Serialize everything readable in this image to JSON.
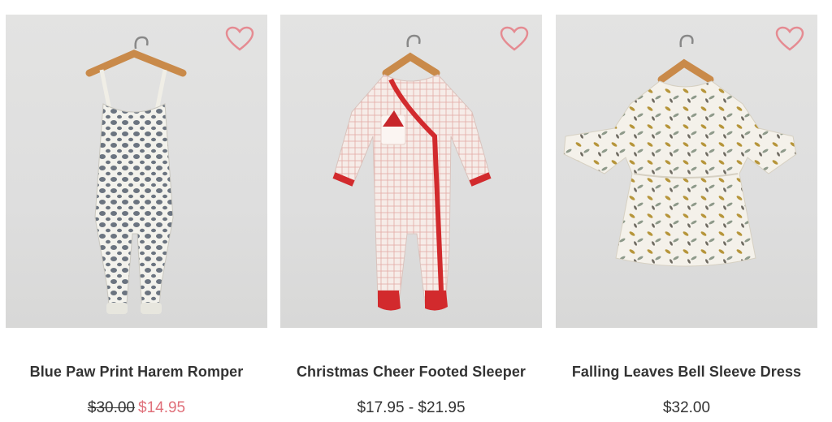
{
  "products": [
    {
      "title": "Blue Paw Print Harem Romper",
      "old_price": "$30.00",
      "price": "$14.95",
      "image_icon": "romper-image",
      "wishlist_icon": "heart-outline-icon"
    },
    {
      "title": "Christmas Cheer Footed Sleeper",
      "price": "$17.95 - $21.95",
      "image_icon": "sleeper-image",
      "wishlist_icon": "heart-outline-icon"
    },
    {
      "title": "Falling Leaves Bell Sleeve Dress",
      "price": "$32.00",
      "image_icon": "dress-image",
      "wishlist_icon": "heart-outline-icon"
    }
  ],
  "colors": {
    "sale": "#e0707a",
    "heart": "#e58b92",
    "text": "#333333",
    "photo_bg": "#dedede"
  }
}
